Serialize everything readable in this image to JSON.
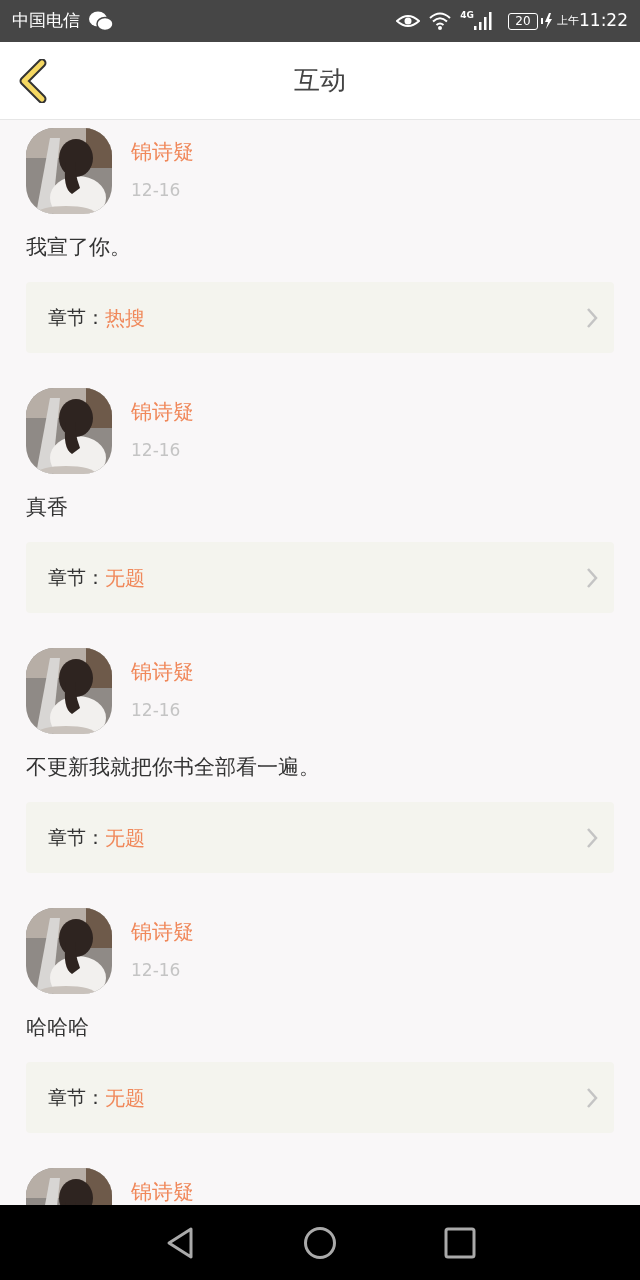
{
  "status_bar": {
    "carrier": "中国电信",
    "network": "4G",
    "battery": "20",
    "period": "上午",
    "time": "11:22"
  },
  "header": {
    "title": "互动"
  },
  "comments": [
    {
      "kind": "picture",
      "author": "锦诗疑",
      "date": "12-16",
      "text": "我宣了你。",
      "chapter_label": "章节：",
      "chapter": "热搜"
    },
    {
      "kind": "picture",
      "author": "锦诗疑",
      "date": "12-16",
      "text": "真香",
      "chapter_label": "章节：",
      "chapter": "无题"
    },
    {
      "kind": "picture",
      "author": "锦诗疑",
      "date": "12-16",
      "text": "不更新我就把你书全部看一遍。",
      "chapter_label": "章节：",
      "chapter": "无题"
    },
    {
      "kind": "picture",
      "author": "锦诗疑",
      "date": "12-16",
      "text": "哈哈哈",
      "chapter_label": "章节：",
      "chapter": "无题"
    },
    {
      "kind": "picture",
      "author": "锦诗疑"
    }
  ]
}
